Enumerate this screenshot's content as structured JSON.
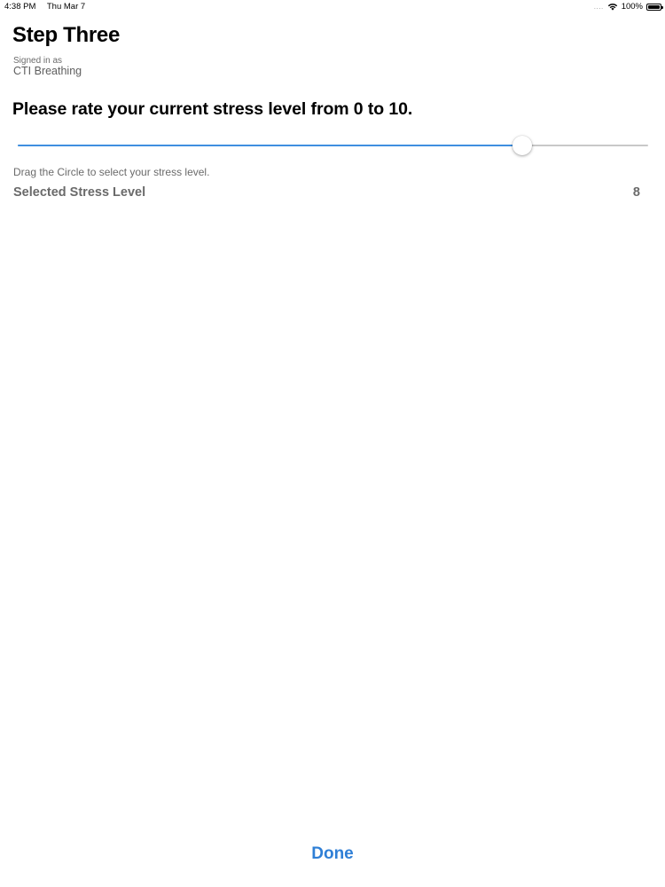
{
  "status_bar": {
    "time": "4:38 PM",
    "date": "Thu Mar 7",
    "signal": "....",
    "battery": "100%",
    "icons": [
      "wifi-icon",
      "battery-icon"
    ]
  },
  "header": {
    "title": "Step Three",
    "signed_in_caption": "Signed in as",
    "signed_in_user": "CTI Breathing"
  },
  "question": "Please rate your current stress level from 0 to 10.",
  "slider": {
    "min": 0,
    "max": 10,
    "value": 8,
    "accent_color": "#3f8fe0"
  },
  "hint": "Drag the Circle to select your stress level.",
  "selected": {
    "label": "Selected Stress Level",
    "value": "8"
  },
  "done_label": "Done",
  "colors": {
    "accent": "#2f7fd6",
    "secondary_text": "#6a6a6a"
  }
}
